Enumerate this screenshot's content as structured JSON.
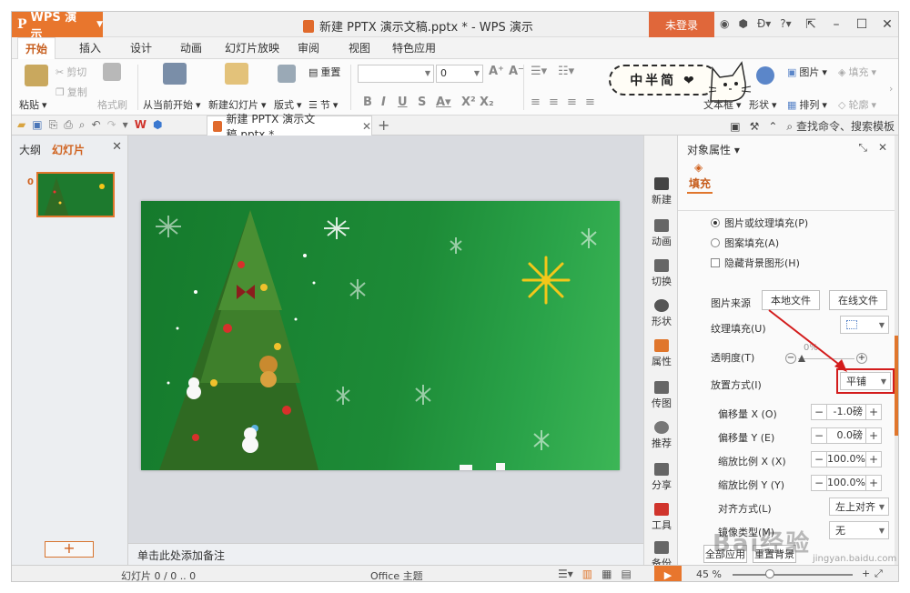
{
  "app": {
    "name": "WPS 演示",
    "logo_char": "P",
    "window_title": "新建 PPTX 演示文稿.pptx * - WPS 演示",
    "login_label": "未登录"
  },
  "menu_tabs": [
    "开始",
    "插入",
    "设计",
    "动画",
    "幻灯片放映",
    "审阅",
    "视图",
    "特色应用"
  ],
  "ribbon": {
    "paste": "粘贴",
    "cut": "剪切",
    "copy": "复制",
    "format_painter": "格式刷",
    "from_current": "从当前开始",
    "new_slide": "新建幻灯片",
    "layout": "版式",
    "reset": "重置",
    "section": "节",
    "font_name": "",
    "font_size": "0",
    "text_box": "文本框",
    "shape": "形状",
    "picture": "图片",
    "arrange": "排列",
    "fill": "填充",
    "outline": "轮廓",
    "sticker_text": "中半简 ❤"
  },
  "doc_tab": {
    "filename": "新建 PPTX 演示文稿.pptx *"
  },
  "quickbar_right": {
    "search": "查找命令、搜索模板"
  },
  "left_panel": {
    "tab_outline": "大纲",
    "tab_slides": "幻灯片",
    "slide_number": "0",
    "add_label": "+"
  },
  "notes_placeholder": "单击此处添加备注",
  "vstrip": [
    "新建",
    "动画",
    "切换",
    "形状",
    "属性",
    "传图",
    "推荐",
    "分享",
    "工具",
    "备份"
  ],
  "properties": {
    "title": "对象属性",
    "tab_fill": "填充",
    "opt_picture_texture": "图片或纹理填充(P)",
    "opt_pattern": "图案填充(A)",
    "opt_hide_bg": "隐藏背景图形(H)",
    "picture_source_label": "图片来源",
    "btn_local_file": "本地文件",
    "btn_online_file": "在线文件",
    "texture_fill_label": "纹理填充(U)",
    "transparency_label": "透明度(T)",
    "transparency_value": "0%",
    "transparency_level": 0,
    "placement_label": "放置方式(I)",
    "placement_value": "平铺",
    "offset_x_label": "偏移量 X (O)",
    "offset_x_value": "-1.0磅",
    "offset_y_label": "偏移量 Y (E)",
    "offset_y_value": "0.0磅",
    "scale_x_label": "缩放比例 X (X)",
    "scale_x_value": "100.0%",
    "scale_y_label": "缩放比例 Y (Y)",
    "scale_y_value": "100.0%",
    "align_label": "对齐方式(L)",
    "align_value": "左上对齐",
    "mirror_label": "镜像类型(M)",
    "mirror_value": "无",
    "btn_apply_all": "全部应用",
    "btn_reset_bg": "重置背景"
  },
  "status": {
    "slide_info": "幻灯片 0 / 0 .. 0",
    "theme": "Office 主题",
    "zoom": "45 %"
  },
  "watermark": {
    "brand": "Bai经验",
    "url": "jingyan.baidu.com"
  },
  "colors": {
    "accent": "#e8762d",
    "slide_green": "#1d8b37",
    "highlight_red": "#d31c1c"
  }
}
